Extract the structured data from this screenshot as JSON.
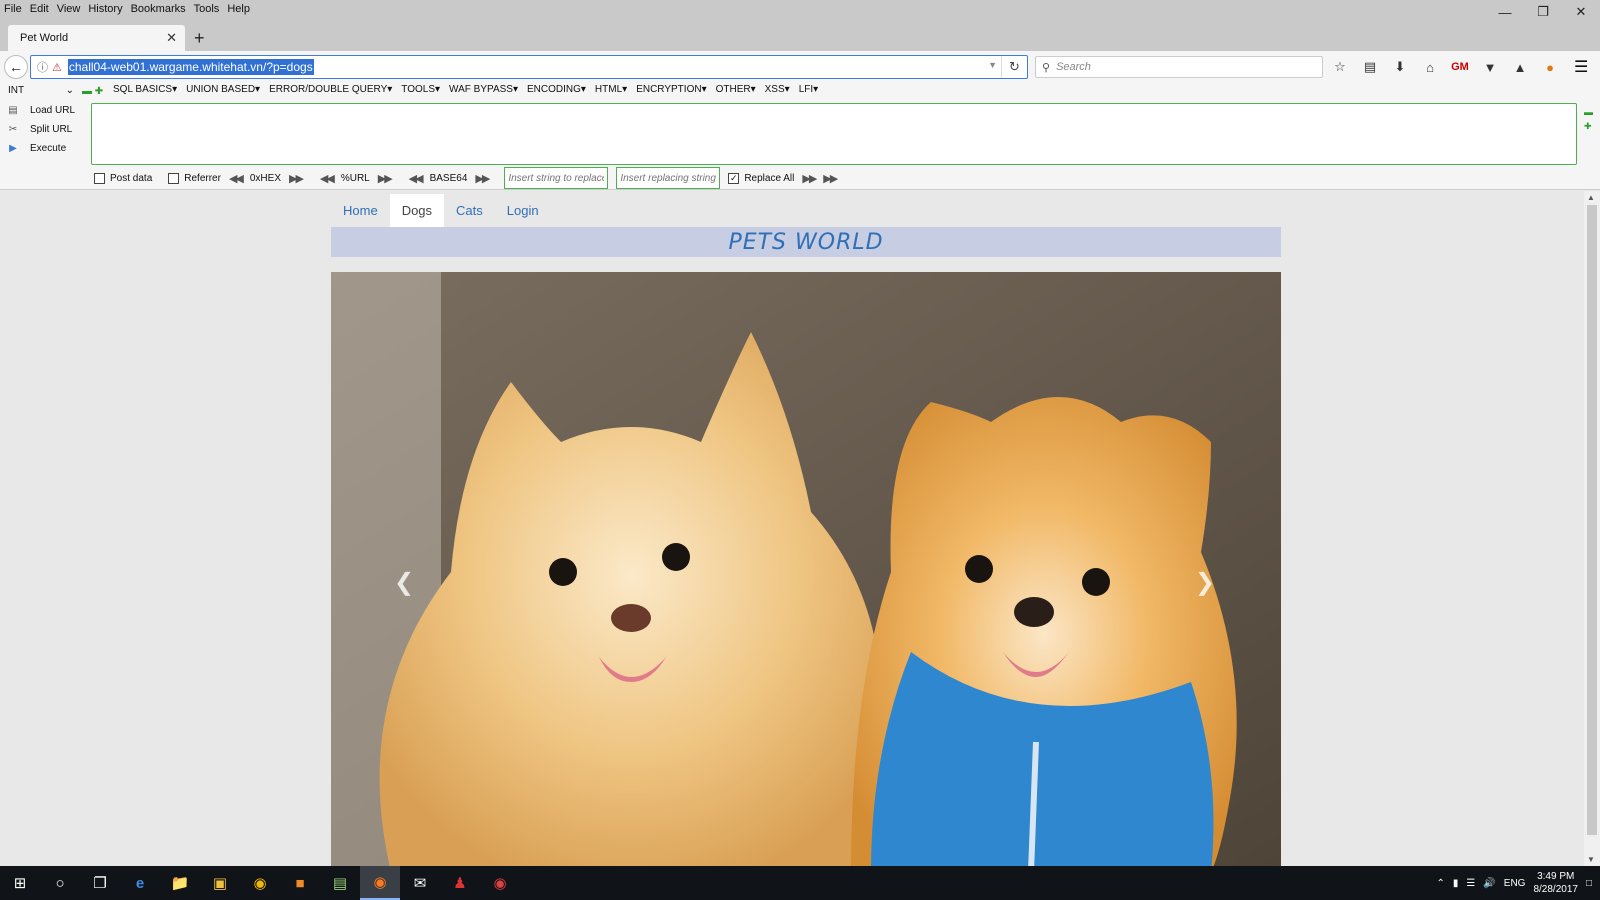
{
  "menu": [
    "File",
    "Edit",
    "View",
    "History",
    "Bookmarks",
    "Tools",
    "Help"
  ],
  "tab": {
    "title": "Pet World"
  },
  "url": "chall04-web01.wargame.whitehat.vn/?p=dogs",
  "search_placeholder": "Search",
  "hackbar": {
    "select": "INT",
    "menus": [
      "SQL BASICS",
      "UNION BASED",
      "ERROR/DOUBLE QUERY",
      "TOOLS",
      "WAF BYPASS",
      "ENCODING",
      "HTML",
      "ENCRYPTION",
      "OTHER",
      "XSS",
      "LFI"
    ],
    "actions": [
      "Load URL",
      "Split URL",
      "Execute"
    ],
    "post_data": "Post data",
    "referrer": "Referrer",
    "hex": "0xHEX",
    "urlenc": "%URL",
    "base64": "BASE64",
    "replace_placeholder": "Insert string to replace",
    "replacing_placeholder": "Insert replacing string",
    "replace_all": "Replace All"
  },
  "site": {
    "nav": [
      "Home",
      "Dogs",
      "Cats",
      "Login"
    ],
    "active": "Dogs",
    "title": "PETS WORLD"
  },
  "taskbar": {
    "lang": "ENG",
    "time": "3:49 PM",
    "date": "8/28/2017"
  }
}
